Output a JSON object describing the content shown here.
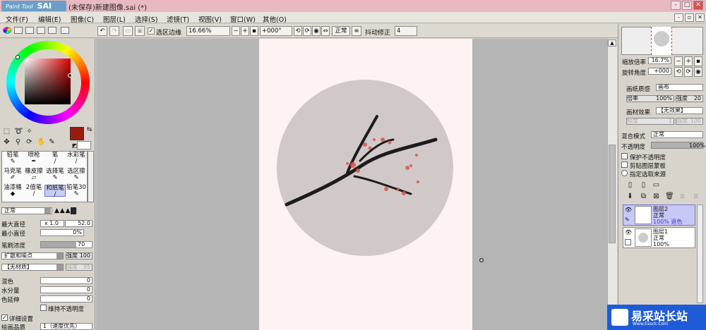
{
  "window": {
    "logo_small": "Paint Tool",
    "logo_big": "SAI",
    "title": "(未保存)新建图像.sai (*)",
    "min": "-",
    "max": "□",
    "close": "✕"
  },
  "menu": [
    "文件(F)",
    "编辑(E)",
    "图像(C)",
    "图层(L)",
    "选择(S)",
    "滤镜(T)",
    "视图(V)",
    "窗口(W)",
    "其他(O)"
  ],
  "toolbar": {
    "select_edge_label": "选区边缘",
    "zoom": "16.66%",
    "rotation": "+000°",
    "blend": "正常",
    "stabilizer_label": "抖动修正",
    "stabilizer": "4"
  },
  "colors": {
    "primary": "#9a1b10",
    "accent": "#e9b9c2",
    "canvas_bg": "#b5b5b5",
    "paper": "#fcf3f2",
    "circle": "#d1c9c9",
    "branch": "#1c1c1c",
    "blossom": "#d9584d"
  },
  "tools": [
    {
      "label": "铅笔"
    },
    {
      "label": "喷枪"
    },
    {
      "label": "笔"
    },
    {
      "label": "水彩笔"
    },
    {
      "label": "马克笔"
    },
    {
      "label": "橡皮擦"
    },
    {
      "label": "选择笔"
    },
    {
      "label": "选区擦"
    },
    {
      "label": "油漆桶"
    },
    {
      "label": "2值笔"
    },
    {
      "label": "和纸笔"
    },
    {
      "label": "铅笔30"
    }
  ],
  "brush": {
    "mode": "正常",
    "max_size_label": "最大直径",
    "max_size_mult": "x 1.0",
    "max_size": "52.0",
    "min_size_label": "最小直径",
    "min_size": "0%",
    "density_label": "笔刷浓度",
    "density": "70",
    "density_fraction": 0.7,
    "shape": "扩散和噪点",
    "strength_label": "强度",
    "strength": "100",
    "texture": "【无材质】",
    "texture_strength": "95",
    "blend_label": "混色",
    "blend": "0",
    "water_label": "水分量",
    "water": "0",
    "persistence_label": "色延伸",
    "persistence": "0",
    "keep_opacity": "维持不透明度",
    "detail_label": "详细设置",
    "quality_label": "绘画品质",
    "quality": "1（速度优先）"
  },
  "navigator": {
    "zoom_label": "缩放倍率",
    "zoom": "16.7%",
    "angle_label": "旋转角度",
    "angle": "+000"
  },
  "paper": {
    "texture_label": "画纸质感",
    "texture": "画布",
    "scale_label": "倍率",
    "scale": "100%",
    "strength_label": "强度",
    "strength": "20",
    "effect_label": "画材效果",
    "effect": "【无效果】",
    "effect_depth_label": "程度",
    "effect_depth": "1",
    "effect_strength_label": "强度",
    "effect_strength": "100"
  },
  "layer_props": {
    "blend_label": "混合模式",
    "blend": "正常",
    "opacity_label": "不透明度",
    "opacity": "100%",
    "protect_alpha": "保护不透明度",
    "clip": "剪贴图层蒙板",
    "selection_source": "指定选取来源"
  },
  "layers": [
    {
      "name": "图层2",
      "mode": "正常",
      "opacity": "100%",
      "extra": "退色"
    },
    {
      "name": "图层1",
      "mode": "正常",
      "opacity": "100%"
    }
  ],
  "watermark": {
    "text": "易采站长站",
    "sub": "Www.Easck.Com"
  }
}
